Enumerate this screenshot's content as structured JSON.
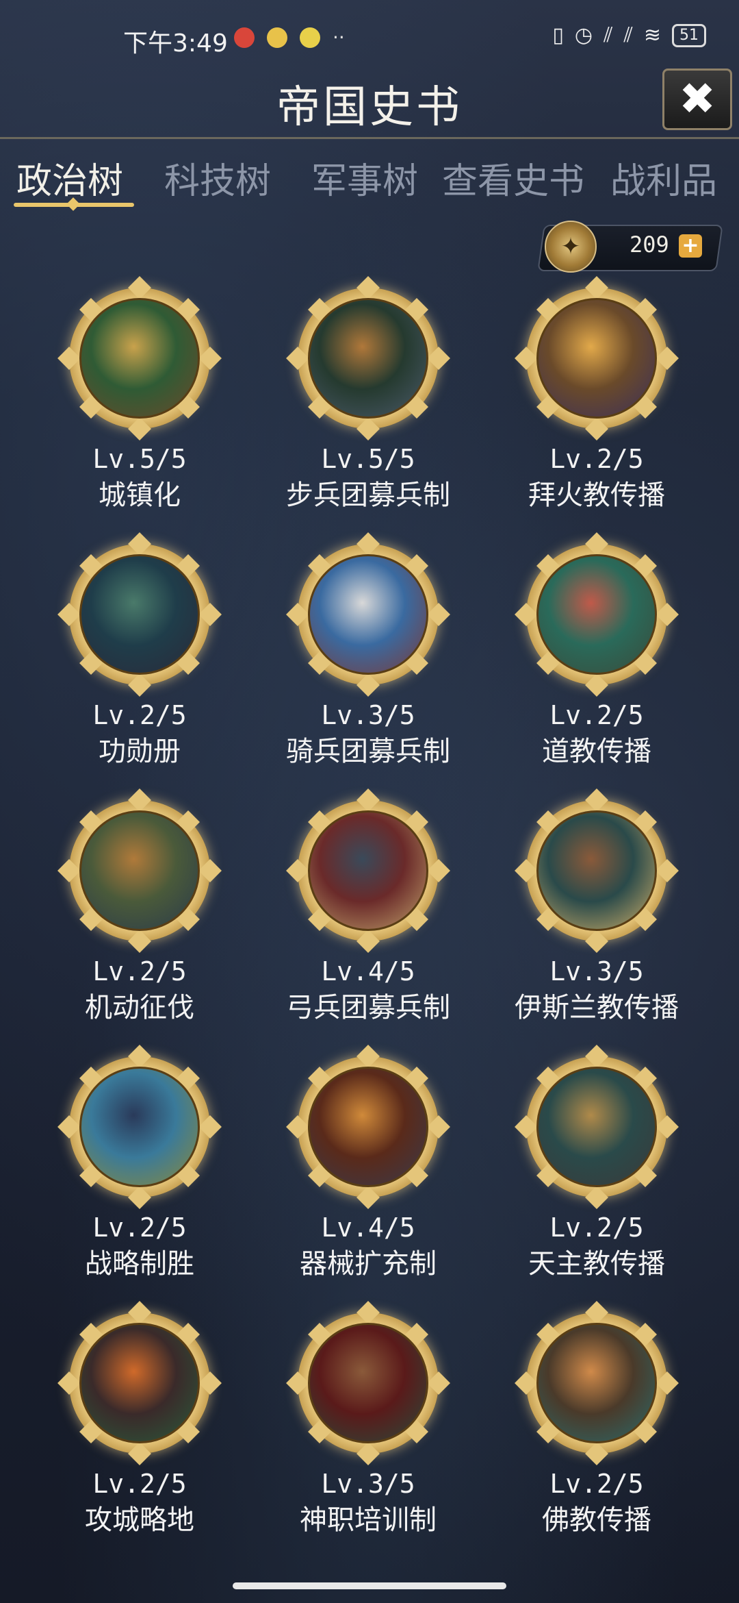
{
  "status_bar": {
    "time": "下午3:49",
    "battery": "51"
  },
  "header": {
    "title": "帝国史书",
    "close_icon": "✖"
  },
  "tabs": [
    {
      "label": "政治树",
      "active": true
    },
    {
      "label": "科技树",
      "active": false
    },
    {
      "label": "军事树",
      "active": false
    },
    {
      "label": "查看史书",
      "active": false
    },
    {
      "label": "战利品",
      "active": false
    }
  ],
  "currency": {
    "value": "209",
    "plus": "+"
  },
  "policies": [
    {
      "level": "Lv.5/5",
      "name": "城镇化",
      "colors": [
        "#2f5b35",
        "#c9a24c",
        "#6b4a2a"
      ]
    },
    {
      "level": "Lv.5/5",
      "name": "步兵团募兵制",
      "colors": [
        "#253a2f",
        "#b0783a",
        "#4b5a6a"
      ]
    },
    {
      "level": "Lv.2/5",
      "name": "拜火教传播",
      "colors": [
        "#6a4a2a",
        "#e2a94a",
        "#3b2f5a"
      ]
    },
    {
      "level": "Lv.2/5",
      "name": "功勋册",
      "colors": [
        "#1f3d4a",
        "#4a7a6a",
        "#2a2a3a"
      ]
    },
    {
      "level": "Lv.3/5",
      "name": "骑兵团募兵制",
      "colors": [
        "#3a6aa0",
        "#d8d8d8",
        "#7a3a3a"
      ]
    },
    {
      "level": "Lv.2/5",
      "name": "道教传播",
      "colors": [
        "#2a6a5a",
        "#c05a4a",
        "#3a4a3a"
      ]
    },
    {
      "level": "Lv.2/5",
      "name": "机动征伐",
      "colors": [
        "#4a5a3a",
        "#b07a3a",
        "#2a3a4a"
      ]
    },
    {
      "level": "Lv.4/5",
      "name": "弓兵团募兵制",
      "colors": [
        "#6a2a2a",
        "#3a4a5a",
        "#c0a06a"
      ]
    },
    {
      "level": "Lv.3/5",
      "name": "伊斯兰教传播",
      "colors": [
        "#2a4a4a",
        "#8a5a3a",
        "#d0b06a"
      ]
    },
    {
      "level": "Lv.2/5",
      "name": "战略制胜",
      "colors": [
        "#3a7a9a",
        "#2a3a5a",
        "#8a8a3a"
      ]
    },
    {
      "level": "Lv.4/5",
      "name": "器械扩充制",
      "colors": [
        "#5a2a1a",
        "#d08a3a",
        "#3a3a4a"
      ]
    },
    {
      "level": "Lv.2/5",
      "name": "天主教传播",
      "colors": [
        "#2a4a4a",
        "#b08a4a",
        "#3a3a3a"
      ]
    },
    {
      "level": "Lv.2/5",
      "name": "攻城略地",
      "colors": [
        "#3a2a2a",
        "#d06a2a",
        "#2a5a3a"
      ]
    },
    {
      "level": "Lv.3/5",
      "name": "神职培训制",
      "colors": [
        "#5a1a1a",
        "#8a5a3a",
        "#2a4a3a"
      ]
    },
    {
      "level": "Lv.2/5",
      "name": "佛教传播",
      "colors": [
        "#4a3a2a",
        "#d08a4a",
        "#2a6a6a"
      ]
    }
  ]
}
